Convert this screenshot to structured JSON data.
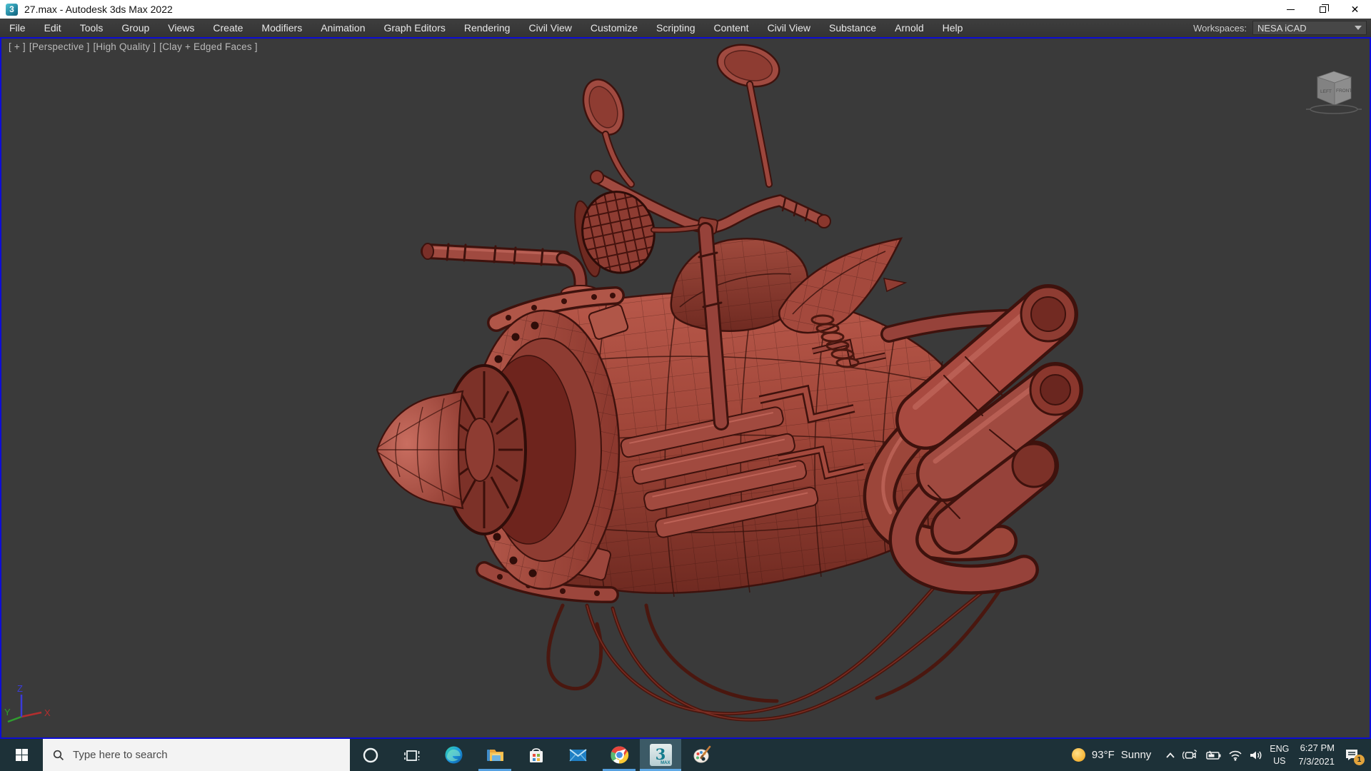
{
  "window": {
    "title": "27.max - Autodesk 3ds Max 2022",
    "app_icon_glyph": "3"
  },
  "menu": {
    "items": [
      "File",
      "Edit",
      "Tools",
      "Group",
      "Views",
      "Create",
      "Modifiers",
      "Animation",
      "Graph Editors",
      "Rendering",
      "Civil View",
      "Customize",
      "Scripting",
      "Content",
      "Civil View",
      "Substance",
      "Arnold",
      "Help"
    ],
    "workspaces_label": "Workspaces:",
    "workspace_value": "NESA iCAD"
  },
  "viewport": {
    "label_tokens": [
      "[ + ]",
      "[Perspective ]",
      "[High Quality ]",
      "[Clay + Edged Faces ]"
    ],
    "viewcube": {
      "front_label": "FRONT",
      "left_label": "LEFT"
    },
    "axis_labels": {
      "x": "X",
      "y": "Y",
      "z": "Z"
    },
    "colors": {
      "background": "#3a3a3a",
      "active_border": "#0c0cd6",
      "clay_base": "#a84a40",
      "clay_shadow": "#7a2f28",
      "wire_line": "#3e120d"
    }
  },
  "taskbar": {
    "search_placeholder": "Type here to search",
    "apps": [
      "Start",
      "Search",
      "Cortana",
      "Task View",
      "Microsoft Edge",
      "File Explorer",
      "Microsoft Store",
      "Mail",
      "Google Chrome",
      "3ds Max",
      "Paint 3D"
    ],
    "active_app": "3ds Max",
    "max_icon_text": {
      "big": "3",
      "small": "MAX"
    },
    "tray": {
      "weather_temp": "93°F",
      "weather_cond": "Sunny",
      "language_line1": "ENG",
      "language_line2": "US",
      "time": "6:27 PM",
      "date": "7/3/2021",
      "notification_badge": "1"
    },
    "colors": {
      "bar": "#1d3138",
      "active_tile": "#3c5a66",
      "underline": "#55a0e0",
      "search_bg": "#f3f3f3"
    }
  }
}
